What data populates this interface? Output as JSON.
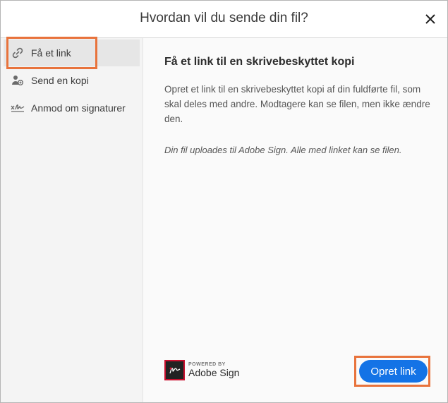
{
  "header": {
    "title": "Hvordan vil du sende din fil?"
  },
  "sidebar": {
    "items": [
      {
        "label": "Få et link",
        "icon": "link-icon",
        "active": true
      },
      {
        "label": "Send en kopi",
        "icon": "person-copy-icon",
        "active": false
      },
      {
        "label": "Anmod om signaturer",
        "icon": "signature-icon",
        "active": false
      }
    ]
  },
  "main": {
    "heading": "Få et link til en skrivebeskyttet kopi",
    "description": "Opret et link til en skrivebeskyttet kopi af din fuldførte fil, som skal deles med andre. Modtagere kan se filen, men ikke ændre den.",
    "note": "Din fil uploades til Adobe Sign. Alle med linket kan se filen."
  },
  "footer": {
    "powered_by": "POWERED BY",
    "brand": "Adobe Sign",
    "button_label": "Opret link"
  },
  "colors": {
    "accent": "#1473e6",
    "highlight": "#e8733c",
    "logo_red": "#c8102e"
  }
}
